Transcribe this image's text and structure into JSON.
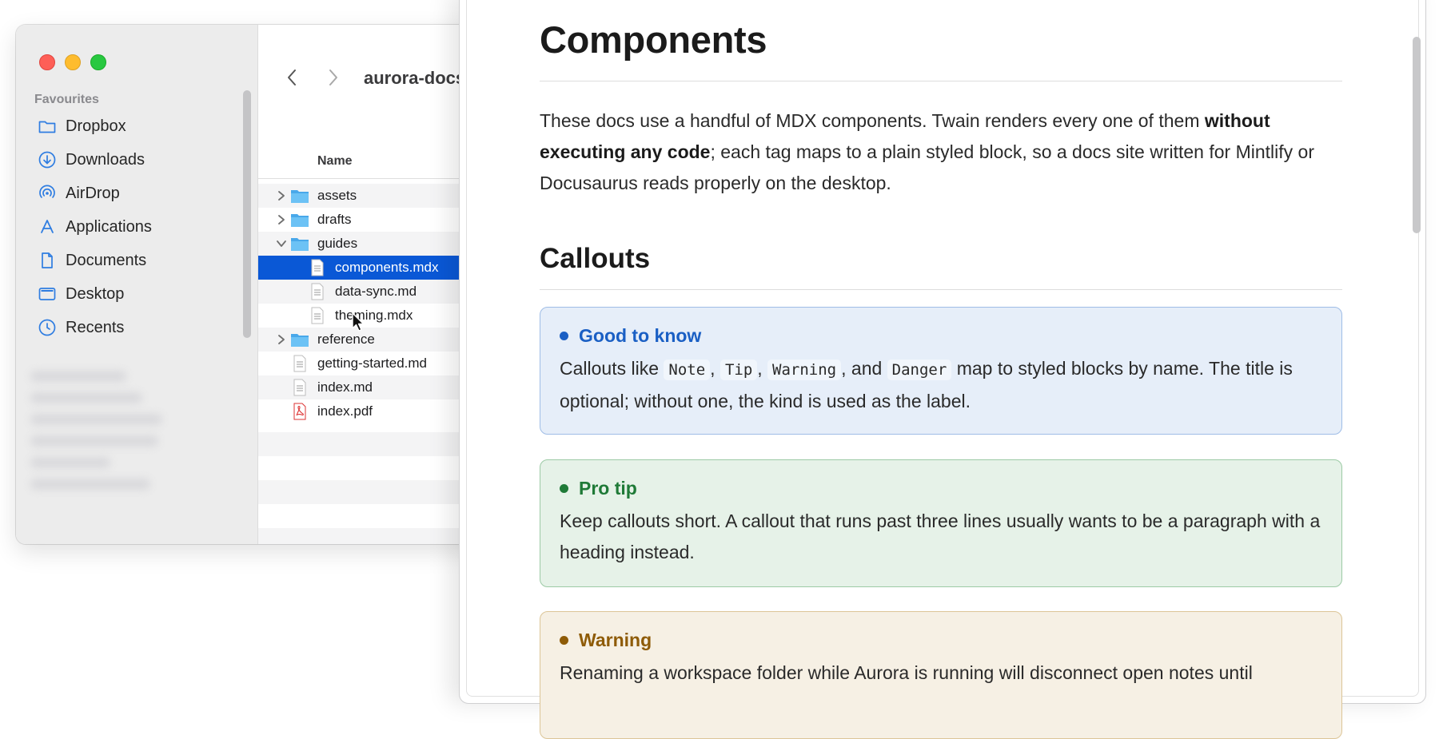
{
  "finder": {
    "sidebar": {
      "section_label": "Favourites",
      "items": [
        {
          "label": "Dropbox",
          "icon": "folder-icon"
        },
        {
          "label": "Downloads",
          "icon": "download-icon"
        },
        {
          "label": "AirDrop",
          "icon": "airdrop-icon"
        },
        {
          "label": "Applications",
          "icon": "applications-icon"
        },
        {
          "label": "Documents",
          "icon": "document-icon"
        },
        {
          "label": "Desktop",
          "icon": "desktop-icon"
        },
        {
          "label": "Recents",
          "icon": "clock-icon"
        }
      ]
    },
    "toolbar": {
      "title": "aurora-docs"
    },
    "list": {
      "column_name": "Name",
      "rows": [
        {
          "label": "assets",
          "type": "folder",
          "expanded": false
        },
        {
          "label": "drafts",
          "type": "folder",
          "expanded": false
        },
        {
          "label": "guides",
          "type": "folder",
          "expanded": true
        },
        {
          "label": "components.mdx",
          "type": "file",
          "selected": true
        },
        {
          "label": "data-sync.md",
          "type": "file"
        },
        {
          "label": "theming.mdx",
          "type": "file"
        },
        {
          "label": "reference",
          "type": "folder",
          "expanded": false
        },
        {
          "label": "getting-started.md",
          "type": "file"
        },
        {
          "label": "index.md",
          "type": "file"
        },
        {
          "label": "index.pdf",
          "type": "pdf"
        }
      ]
    }
  },
  "preview": {
    "title": "Components",
    "intro_part1": "These docs use a handful of MDX components. Twain renders every one of them ",
    "intro_bold": "without executing any code",
    "intro_part2": "; each tag maps to a plain styled block, so a docs site written for Mintlify or Docusaurus reads properly on the desktop.",
    "section_heading": "Callouts",
    "callouts": [
      {
        "title": "Good to know",
        "body_prefix": "Callouts like ",
        "code1": "Note",
        "sep1": ", ",
        "code2": "Tip",
        "sep2": ", ",
        "code3": "Warning",
        "sep3": ", and ",
        "code4": "Danger",
        "body_suffix": " map to styled blocks by name. The title is optional; without one, the kind is used as the label.",
        "color": "#1a5fc4"
      },
      {
        "title": "Pro tip",
        "body": "Keep callouts short. A callout that runs past three lines usually wants to be a paragraph with a heading instead.",
        "color": "#1f7a37"
      },
      {
        "title": "Warning",
        "body": "Renaming a workspace folder while Aurora is running will disconnect open notes until",
        "color": "#8e5b07"
      }
    ]
  }
}
